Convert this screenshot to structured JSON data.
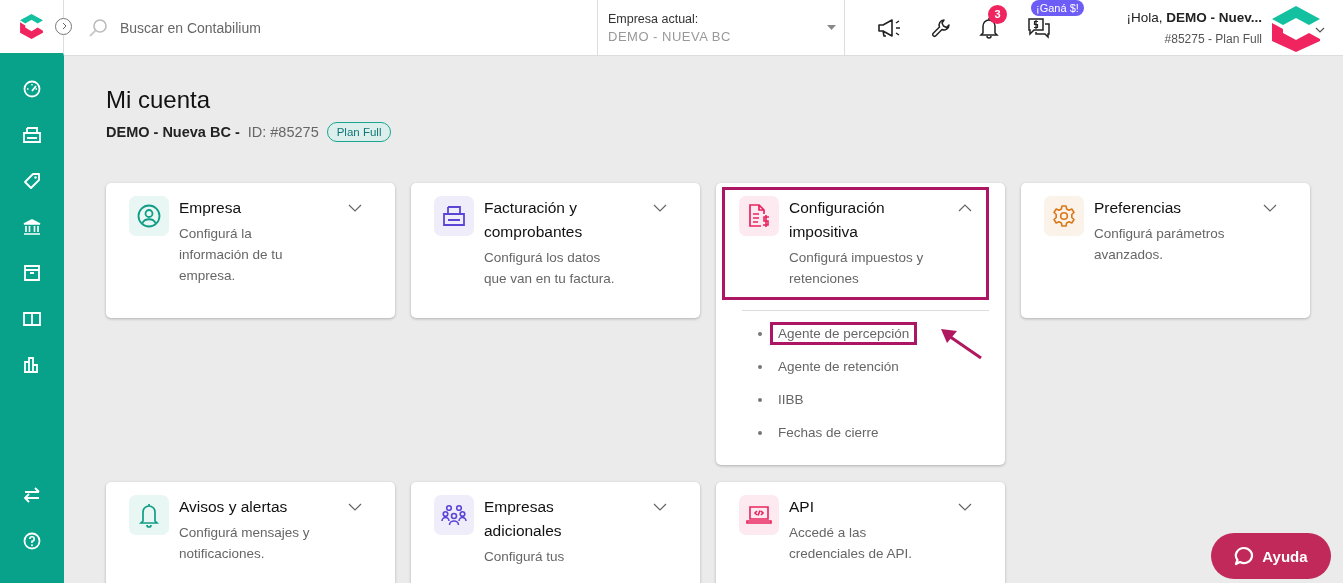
{
  "topbar": {
    "search": {
      "placeholder": "Buscar en Contabilium"
    },
    "company": {
      "label": "Empresa actual:",
      "value": "DEMO - NUEVA BC"
    },
    "notifications": {
      "count": "3"
    },
    "promo": {
      "badge": "¡Ganá $!"
    },
    "user": {
      "greeting": "¡Hola, **DEMO - Nuev...**",
      "account": "#85275 - Plan Full"
    }
  },
  "header": {
    "title": "Mi cuenta",
    "company": "DEMO - Nueva BC -",
    "id": "ID: #85275",
    "plan": "Plan Full"
  },
  "cards": [
    {
      "title": "Empresa",
      "description": "Configurá la información de tu empresa.",
      "color": "#0f9d86",
      "expanded": false,
      "highlighted": false
    },
    {
      "title": "Facturación y comprobantes",
      "description": "Configurá los datos que van en tu factura.",
      "color": "#5b45d6",
      "expanded": false,
      "highlighted": false
    },
    {
      "title": "Configuración impositiva",
      "description": "Configurá impuestos y retenciones",
      "color": "#e8245f",
      "expanded": true,
      "highlighted": true,
      "items": [
        {
          "label": "Agente de percepción",
          "highlighted": true
        },
        {
          "label": "Agente de retención",
          "highlighted": false
        },
        {
          "label": "IIBB",
          "highlighted": false
        },
        {
          "label": "Fechas de cierre",
          "highlighted": false
        }
      ]
    },
    {
      "title": "Preferencias",
      "description": "Configurá parámetros avanzados.",
      "color": "#d9791a",
      "expanded": false,
      "highlighted": false
    },
    {
      "title": "Avisos y alertas",
      "description": "Configurá mensajes y notificaciones.",
      "color": "#0f9d86",
      "expanded": false,
      "highlighted": false
    },
    {
      "title": "Empresas adicionales",
      "description": "Configurá tus",
      "color": "#5b45d6",
      "expanded": false,
      "highlighted": false
    },
    {
      "title": "API",
      "description": "Accedé a las credenciales de API.",
      "color": "#e8245f",
      "expanded": false,
      "highlighted": false
    }
  ],
  "help_button": {
    "label": "Ayuda"
  }
}
